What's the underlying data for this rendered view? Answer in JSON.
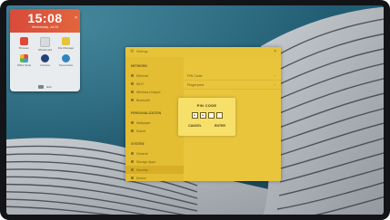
{
  "widget": {
    "time": "15:08",
    "date": "Wednesday, Jul 24",
    "close_glyph": "×",
    "apps": [
      {
        "label": "Browser",
        "icon": "browser-icon",
        "color": "#e0473b"
      },
      {
        "label": "Whiteboard",
        "icon": "whiteboard-icon",
        "color": "#d7d9dc"
      },
      {
        "label": "File Manager",
        "icon": "files-icon",
        "color": "#e7c33a"
      },
      {
        "label": "Office Suite",
        "icon": "office-icon",
        "color": "#3aa0d8"
      },
      {
        "label": "Camera",
        "icon": "camera-icon",
        "color": "#24407a"
      },
      {
        "label": "Screenshot",
        "icon": "screenshot-icon",
        "color": "#2e86c1"
      }
    ],
    "footer_label": "Exit"
  },
  "settings": {
    "title": "Settings",
    "close_glyph": "×",
    "sections": [
      {
        "title": "NETWORK",
        "items": [
          "Ethernet",
          "Wi-Fi",
          "Wireless Hotspot",
          "Bluetooth"
        ]
      },
      {
        "title": "PERSONALIZATION",
        "items": [
          "Wallpaper",
          "Sound"
        ]
      },
      {
        "title": "SYSTEM",
        "items": [
          "General",
          "Storage Apps",
          "Security",
          "Device"
        ]
      }
    ],
    "content_rows": [
      {
        "label": "PIN Code",
        "chevron": "›"
      },
      {
        "label": "Fingerprint",
        "chevron": "›"
      }
    ]
  },
  "pin_dialog": {
    "title": "PIN CODE",
    "digits": [
      "•",
      "•",
      "",
      ""
    ],
    "cancel_label": "CANCEL",
    "enter_label": "ENTER"
  },
  "colors": {
    "accent_red": "#d94a3a",
    "settings_yellow": "#e9c53c",
    "dialog_yellow": "#f7e069"
  }
}
